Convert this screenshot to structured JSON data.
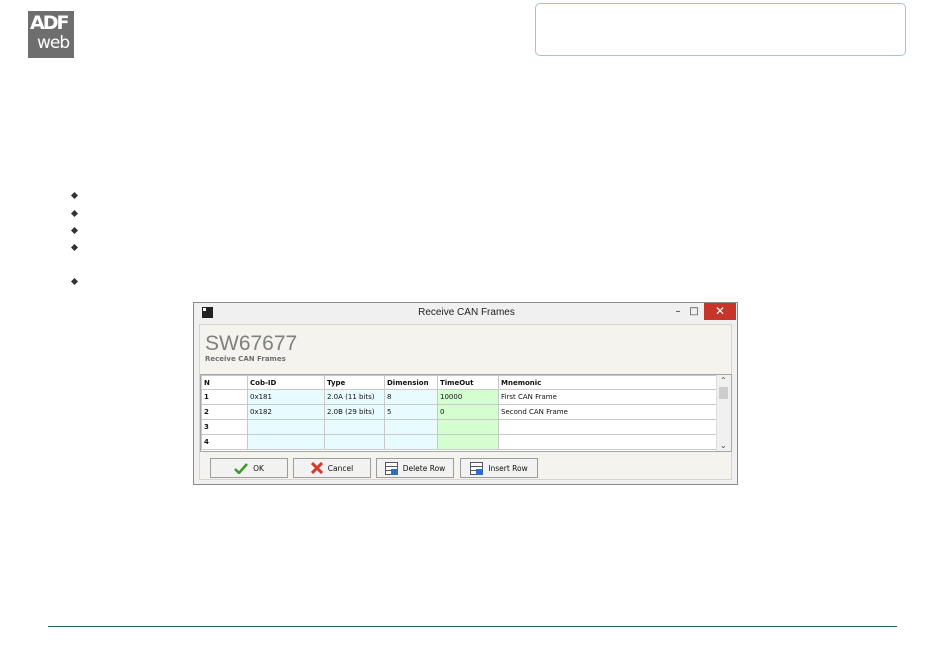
{
  "logo": {
    "line1": "ADF",
    "line2": "web"
  },
  "dialog": {
    "title": "Receive CAN Frames",
    "product_code": "SW67677",
    "subtitle": "Receive CAN Frames",
    "window_buttons": {
      "minimize": "–",
      "maximize": "□",
      "close": "✕"
    },
    "columns": [
      "N",
      "Cob-ID",
      "Type",
      "Dimension",
      "TimeOut",
      "Mnemonic"
    ],
    "rows": [
      {
        "n": "1",
        "cob": "0x181",
        "type": "2.0A (11 bits)",
        "dim": "8",
        "timeout": "10000",
        "mnemonic": "First CAN Frame"
      },
      {
        "n": "2",
        "cob": "0x182",
        "type": "2.0B (29 bits)",
        "dim": "5",
        "timeout": "0",
        "mnemonic": "Second CAN Frame"
      },
      {
        "n": "3",
        "cob": "",
        "type": "",
        "dim": "",
        "timeout": "",
        "mnemonic": ""
      },
      {
        "n": "4",
        "cob": "",
        "type": "",
        "dim": "",
        "timeout": "",
        "mnemonic": ""
      }
    ],
    "buttons": {
      "ok": "OK",
      "cancel": "Cancel",
      "delete_row": "Delete Row",
      "insert_row": "Insert Row"
    },
    "scroll": {
      "up": "⌃",
      "down": "⌄"
    }
  },
  "colors": {
    "close": "#c7352a",
    "id_cells": "#e8fbff",
    "timeout_cells": "#d4fdd0",
    "info_border": "#9fc3e2"
  }
}
